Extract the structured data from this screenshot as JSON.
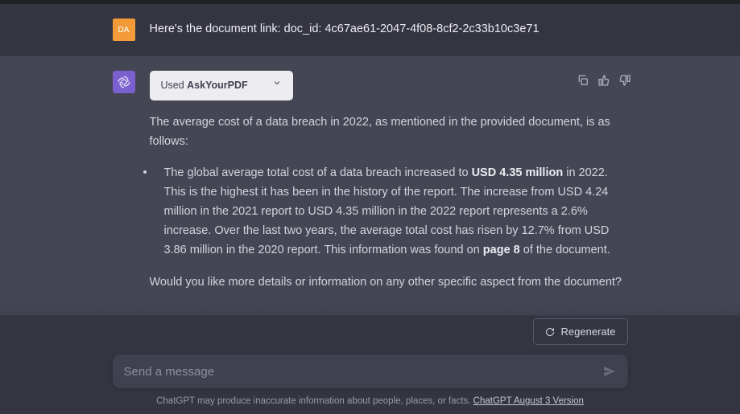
{
  "user": {
    "avatar_initials": "DA",
    "message": "Here's the document link: doc_id: 4c67ae61-2047-4f08-8cf2-2c33b10c3e71"
  },
  "assistant": {
    "plugin_used_prefix": "Used ",
    "plugin_name": "AskYourPDF",
    "intro": "The average cost of a data breach in 2022, as mentioned in the provided document, is as follows:",
    "bullet_pre": "The global average total cost of a data breach increased to ",
    "bullet_bold1": "USD 4.35 million",
    "bullet_mid": " in 2022. This is the highest it has been in the history of the report. The increase from USD 4.24 million in the 2021 report to USD 4.35 million in the 2022 report represents a 2.6% increase. Over the last two years, the average total cost has risen by 12.7% from USD 3.86 million in the 2020 report. This information was found on ",
    "bullet_bold2": "page 8",
    "bullet_post": " of the document.",
    "followup": "Would you like more details or information on any other specific aspect from the document?"
  },
  "controls": {
    "regenerate": "Regenerate"
  },
  "input": {
    "placeholder": "Send a message"
  },
  "footer": {
    "disclaimer": "ChatGPT may produce inaccurate information about people, places, or facts. ",
    "version_link": "ChatGPT August 3 Version"
  }
}
